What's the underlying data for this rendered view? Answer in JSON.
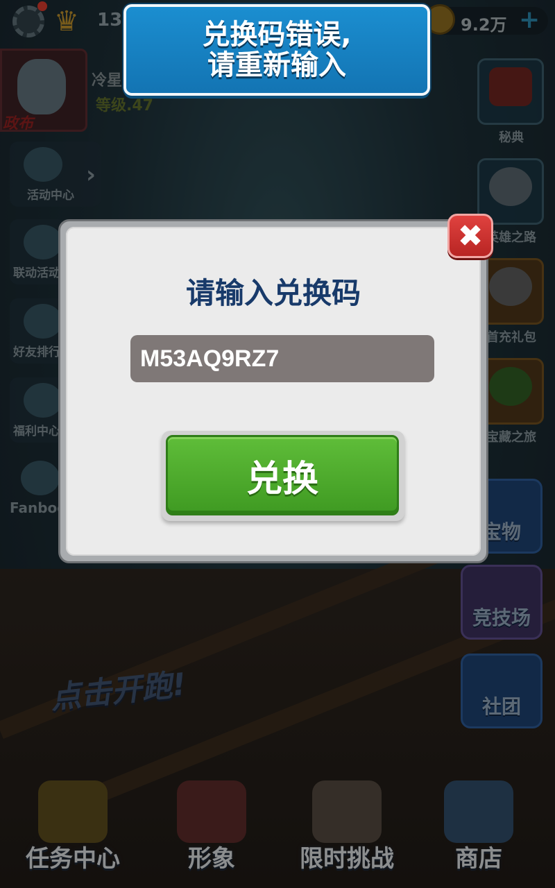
{
  "banner": {
    "message": "兑换码错误,\n请重新输入"
  },
  "topbar": {
    "level_prefix": "13",
    "coins": "9.2万",
    "plus": "+"
  },
  "player": {
    "tag": "政布",
    "name": "冷星",
    "level": "等级.47"
  },
  "left_menu": [
    {
      "label": "活动中心",
      "icon": "globe-icon"
    },
    {
      "label": "联动活动",
      "icon": "plant-icon"
    },
    {
      "label": "好友排行",
      "icon": "friends-icon"
    },
    {
      "label": "福利中心",
      "icon": "gift-bag-icon"
    },
    {
      "label": "Fanbook",
      "icon": "fanbook-icon"
    }
  ],
  "right_menu": [
    {
      "label": "秘典",
      "icon": "book-icon"
    },
    {
      "label": "英雄之路",
      "icon": "hero-icon"
    },
    {
      "label": "首充礼包",
      "icon": "rabbit-icon"
    },
    {
      "label": "宝藏之旅",
      "icon": "plant-icon"
    }
  ],
  "right_big": [
    {
      "label": "宝物",
      "icon": "treasure-icon"
    },
    {
      "label": "竞技场",
      "icon": "vs-icon"
    },
    {
      "label": "社团",
      "icon": "club-icon"
    }
  ],
  "tap_start": "点击开跑!",
  "bottom_nav": [
    {
      "label": "任务中心",
      "icon": "trophy-icon"
    },
    {
      "label": "形象",
      "icon": "character-icon"
    },
    {
      "label": "限时挑战",
      "icon": "calendar-icon"
    },
    {
      "label": "商店",
      "icon": "money-bag-icon"
    }
  ],
  "dialog": {
    "title": "请输入兑换码",
    "code_value": "M53AQ9RZ7",
    "redeem_label": "兑换",
    "close_symbol": "✖"
  },
  "colors": {
    "banner": "#1b8ed0",
    "redeem": "#4caf2a",
    "close": "#d0302d",
    "title": "#183a6a"
  }
}
